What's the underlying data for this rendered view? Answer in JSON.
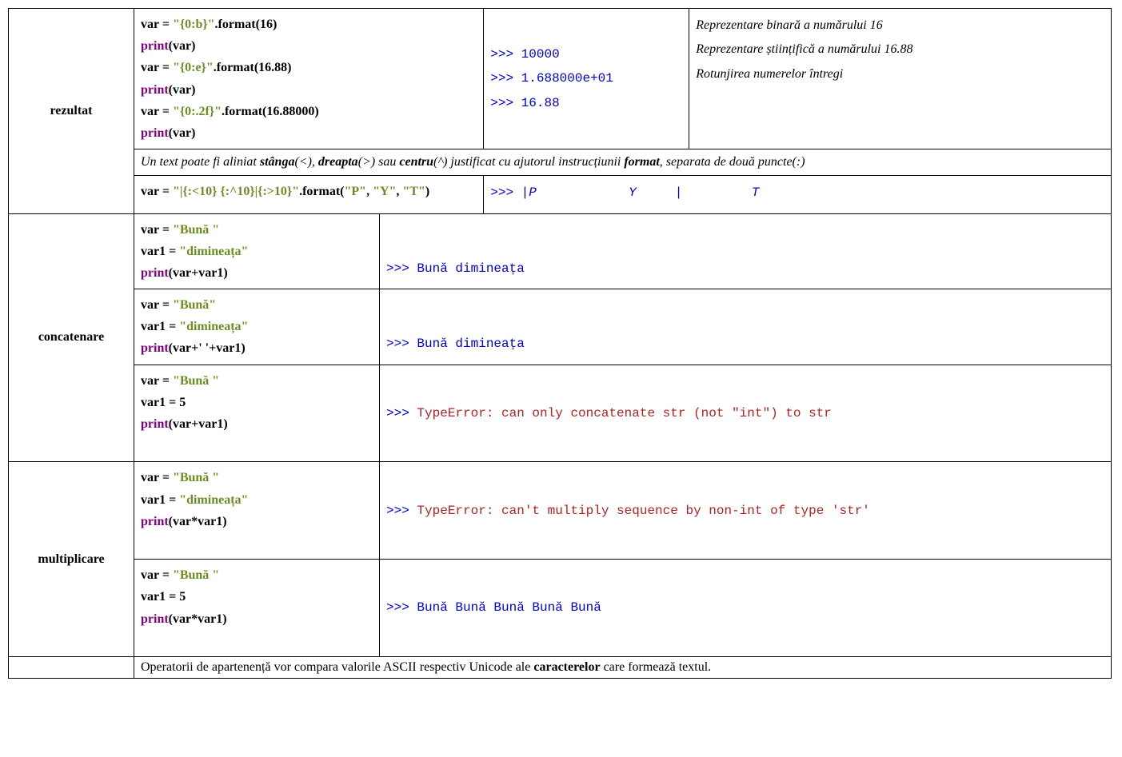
{
  "labels": {
    "rezultat": "rezultat",
    "concatenare": "concatenare",
    "multiplicare": "multiplicare"
  },
  "rezultat": {
    "code": {
      "l1_var": "var = ",
      "l1_str": "\"{0:b}\"",
      "l1_fmt": ".format(16)",
      "l2_print": "print",
      "l2_arg": "(var)",
      "l3_var": "var = ",
      "l3_str": "\"{0:e}\"",
      "l3_fmt": ".format(16.88)",
      "l4_print": "print",
      "l4_arg": "(var)",
      "l5_var": "var = ",
      "l5_str": "\"{0:.2f}\"",
      "l5_fmt": ".format(16.88000)",
      "l6_print": "print",
      "l6_arg": "(var)"
    },
    "out1": "10000",
    "out2": "1.688000e+01",
    "out3": "16.88",
    "note1": "Reprezentare binară a numărului 16",
    "note2": "Reprezentare științifică a numărului 16.88",
    "note3": "Rotunjirea numerelor întregi",
    "align_desc": {
      "pre": "Un text poate fi aliniat ",
      "stanga": "stânga",
      "stanga_sym": "(<), ",
      "dreapta": "dreapta",
      "dreapta_sym": "(>) sau ",
      "centru": "centru",
      "centru_sym": "(^) justificat cu ajutorul instrucțiunii ",
      "format": "format",
      "post": ", separata de două puncte(:)"
    },
    "align_code": {
      "var": "var = ",
      "str": "\"|{:<10} {:^10}|{:>10}\"",
      "fmt1": ".format(",
      "p": "\"P\"",
      "c1": ", ",
      "y": "\"Y\"",
      "c2": ", ",
      "t": "\"T\"",
      "close": ")"
    },
    "align_out": "|P            Y     |         T"
  },
  "concat": {
    "r1": {
      "l1_var": "var = ",
      "l1_str": "\"Bună \"",
      "l2_var": "var1 = ",
      "l2_str": "\"dimineața\"",
      "l3_print": "print",
      "l3_arg": "(var+var1)",
      "out": "Bună dimineața"
    },
    "r2": {
      "l1_var": "var = ",
      "l1_str": "\"Bună\"",
      "l2_var": "var1 = ",
      "l2_str": "\"dimineața\"",
      "l3_print": "print",
      "l3_arg": "(var+' '+var1)",
      "out": "Bună dimineața"
    },
    "r3": {
      "l1_var": "var = ",
      "l1_str": "\"Bună \"",
      "l2_var": "var1 = 5",
      "l3_print": "print",
      "l3_arg": "(var+var1)",
      "out": "TypeError: can only concatenate str (not \"int\") to str"
    }
  },
  "mult": {
    "r1": {
      "l1_var": "var = ",
      "l1_str": "\"Bună \"",
      "l2_var": "var1 = ",
      "l2_str": "\"dimineața\"",
      "l3_print": "print",
      "l3_arg": "(var*var1)",
      "out": "TypeError: can't multiply sequence by non-int of type 'str'"
    },
    "r2": {
      "l1_var": "var = ",
      "l1_str": "\"Bună \"",
      "l2_var": "var1 = 5",
      "l3_print": "print",
      "l3_arg": "(var*var1)",
      "out": "Bună Bună Bună Bună Bună"
    }
  },
  "footer": {
    "pre": "Operatorii de apartenență vor compara valorile ASCII respectiv Unicode ale ",
    "bold": "caracterelor",
    "post": " care formează textul."
  },
  "prompt": ">>> "
}
